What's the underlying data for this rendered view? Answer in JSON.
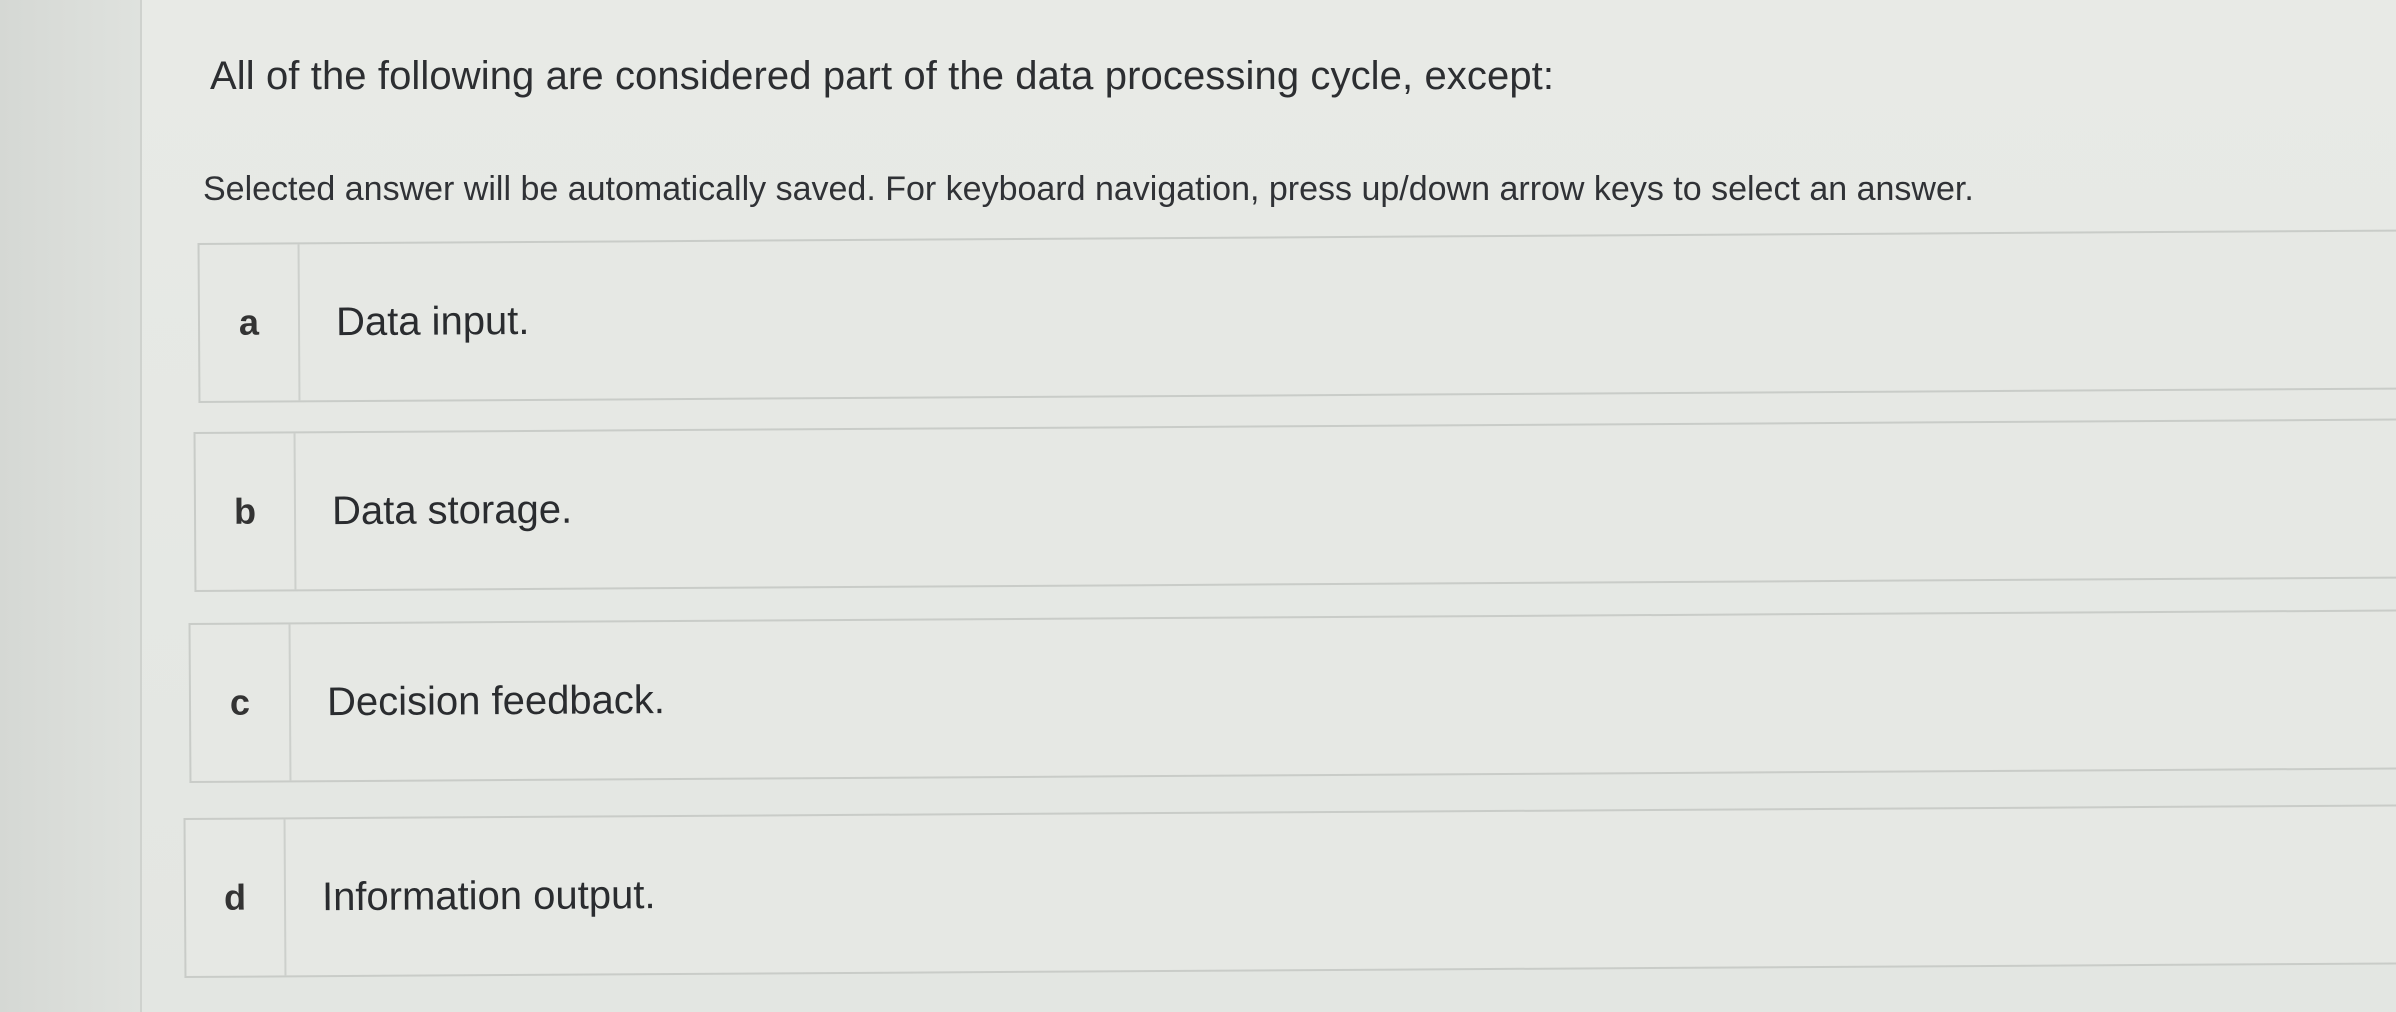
{
  "question": {
    "text": "All of the following are considered part of the data processing cycle, except:",
    "instructions": "Selected answer will be automatically saved. For keyboard navigation, press up/down arrow keys to select an answer."
  },
  "options": [
    {
      "letter": "a",
      "text": "Data input."
    },
    {
      "letter": "b",
      "text": "Data storage."
    },
    {
      "letter": "c",
      "text": "Decision feedback."
    },
    {
      "letter": "d",
      "text": "Information output."
    }
  ]
}
